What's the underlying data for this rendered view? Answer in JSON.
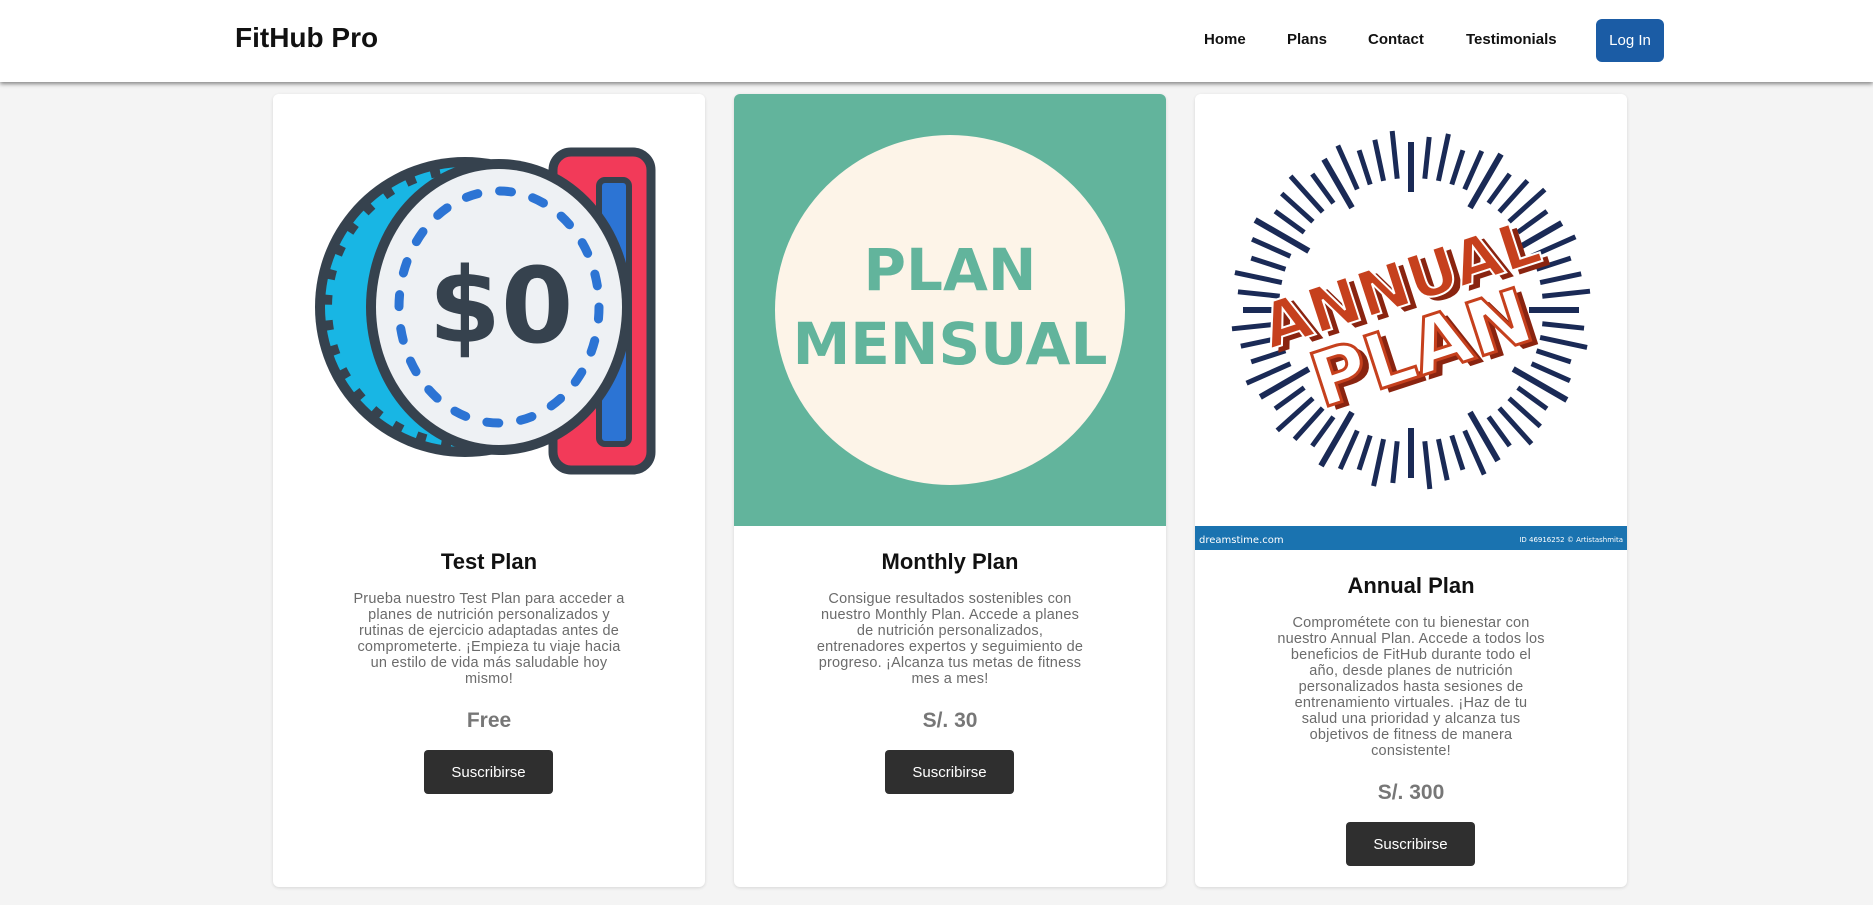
{
  "header": {
    "brand": "FitHub Pro",
    "nav": [
      "Home",
      "Plans",
      "Contact",
      "Testimonials"
    ],
    "login_label": "Log In"
  },
  "plans": [
    {
      "title": "Test Plan",
      "image_text": "$0",
      "description": "Prueba nuestro Test Plan para acceder a planes de nutrición personalizados y rutinas de ejercicio adaptadas antes de comprometerte. ¡Empieza tu viaje hacia un estilo de vida más saludable hoy mismo!",
      "price": "Free",
      "button": "Suscribirse"
    },
    {
      "title": "Monthly Plan",
      "image_text_line1": "PLAN",
      "image_text_line2": "MENSUAL",
      "description": "Consigue resultados sostenibles con nuestro Monthly Plan. Accede a planes de nutrición personalizados, entrenadores expertos y seguimiento de progreso. ¡Alcanza tus metas de fitness mes a mes!",
      "price": "S/. 30",
      "button": "Suscribirse"
    },
    {
      "title": "Annual Plan",
      "image_text_line1": "ANNUAL",
      "image_text_line2": "PLAN",
      "image_footer_left": "dreamstime.com",
      "image_footer_right": "ID 46916252 © Artistashmita",
      "description": "Comprométete con tu bienestar con nuestro Annual Plan. Accede a todos los beneficios de FitHub durante todo el año, desde planes de nutrición personalizados hasta sesiones de entrenamiento virtuales. ¡Haz de tu salud una prioridad y alcanza tus objetivos de fitness de manera consistente!",
      "price": "S/. 300",
      "button": "Suscribirse"
    }
  ],
  "colors": {
    "login": "#1b5ca5",
    "button": "#2f2f2f",
    "monthly_bg": "#62b49c",
    "monthly_circle": "#fdf4e8",
    "annual_text": "#c6401d",
    "annual_ticks": "#1a2a56",
    "annual_footer": "#1a73b0",
    "coin_outline": "#36424e",
    "coin_edge": "#18b6e4",
    "coin_red": "#f23a59"
  }
}
